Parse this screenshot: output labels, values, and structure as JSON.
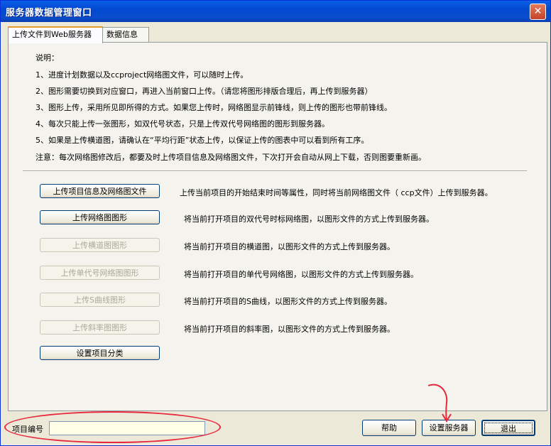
{
  "window": {
    "title": "服务器数据管理窗口",
    "close": "✕"
  },
  "tabs": [
    {
      "label": "上传文件到Web服务器"
    },
    {
      "label": "数据信息"
    }
  ],
  "description": {
    "heading": "说明：",
    "lines": [
      "1、进度计划数据以及ccproject网络图文件，可以随时上传。",
      "2、图形需要切换到对应窗口，再进入当前窗口上传。（请您将图形排版合理后，再上传到服务器）",
      "3、图形上传，采用所见即所得的方式。如果您上传时，网络图显示前锋线，则上传的图形也带前锋线。",
      "4、每次只能上传一张图形，如双代号状态，只是上传双代号网络图的图形到服务器。",
      "5、如果是上传横道图，请确认在“平均行距”状态上传，以保证上传的图表中可以看到所有工序。"
    ],
    "note": "注意：每次网络图修改后，都要及时上传项目信息及网络图文件，下次打开会自动从网上下载，否则图要重新画。"
  },
  "operations": [
    {
      "button": "上传项目信息及网络图文件",
      "desc": "上传当前项目的开始结束时间等属性，同时将当前网络图文件（ ccp文件）上传到服务器。",
      "enabled": true
    },
    {
      "button": "上传网络图图形",
      "desc": "将当前打开项目的双代号时标网络图，以图形文件的方式上传到服务器。",
      "enabled": true
    },
    {
      "button": "上传横道图图形",
      "desc": "将当前打开项目的横道图，以图形文件的方式上传到服务器。",
      "enabled": false
    },
    {
      "button": "上传单代号网络图图形",
      "desc": "将当前打开项目的单代号网络图，以图形文件的方式上传到服务器。",
      "enabled": false
    },
    {
      "button": "上传S曲线图形",
      "desc": "将当前打开项目的S曲线，以图形文件的方式上传到服务器。",
      "enabled": false
    },
    {
      "button": "上传斜率图图形",
      "desc": "将当前打开项目的斜率图，以图形文件的方式上传到服务器。",
      "enabled": false
    }
  ],
  "category_button": "设置项目分类",
  "footer": {
    "project_label": "项目编号",
    "project_value": "",
    "help": "帮助",
    "server_settings": "设置服务器",
    "exit": "退出"
  },
  "annotation_color": "#e8283c"
}
